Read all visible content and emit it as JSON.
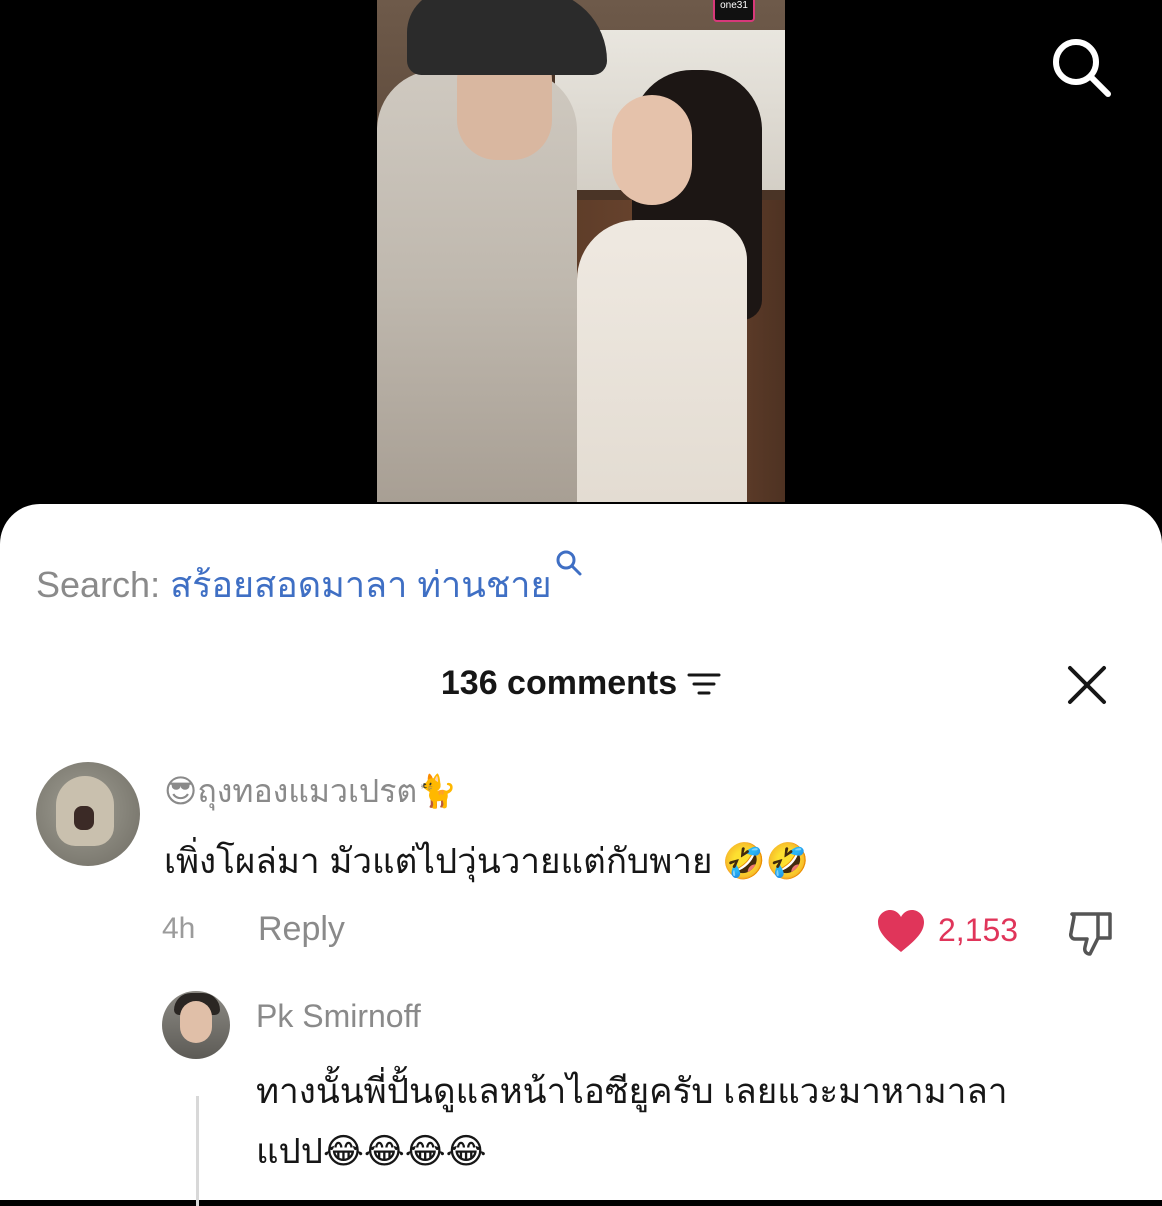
{
  "video": {
    "channel_logo_text": "one31"
  },
  "search": {
    "label": "Search:",
    "query": "สร้อยสอดมาลา ท่านชาย"
  },
  "comments_panel": {
    "title": "136 comments",
    "icons": {
      "filter": "filter-lines-icon",
      "close": "close-x-icon",
      "top_search": "magnifier-icon"
    }
  },
  "comments": [
    {
      "username": "😎ถุงทองแมวเปรต🐈",
      "text": "เพิ่งโผล่มา มัวแต่ไปวุ่นวายแต่กับพาย 🤣🤣",
      "time": "4h",
      "reply_label": "Reply",
      "likes": "2,153"
    }
  ],
  "replies": [
    {
      "username": "Pk Smirnoff",
      "text_line1": "ทางนั้นพี่ปั้นดูแลหน้าไอซียูครับ เลยแวะมาหามาลา",
      "text_line2": "แปป😂😂😂😂"
    }
  ],
  "colors": {
    "link_blue": "#3f6fc4",
    "like_red": "#e0355a",
    "muted_gray": "#8a8a8a"
  }
}
